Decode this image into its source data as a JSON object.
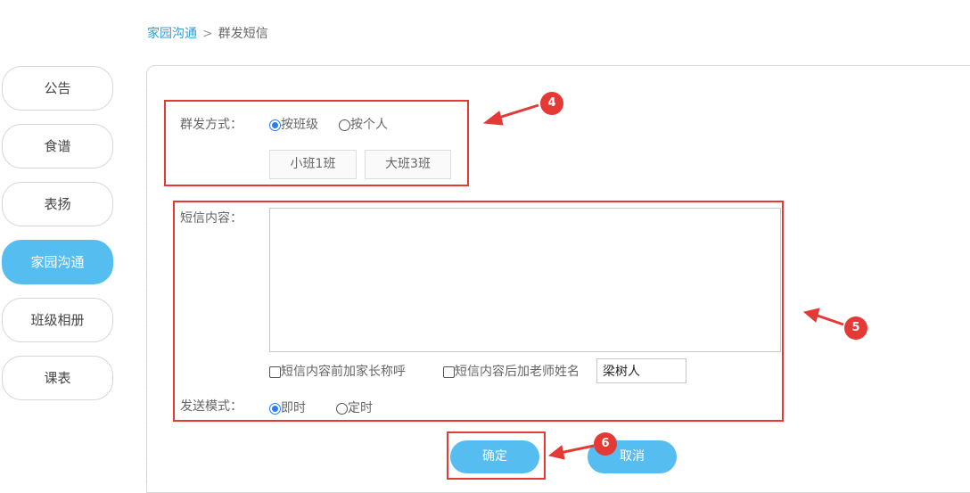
{
  "breadcrumb": {
    "parent": "家园沟通",
    "separator": ">",
    "current": "群发短信"
  },
  "sidebar": {
    "items": [
      {
        "label": "公告"
      },
      {
        "label": "食谱"
      },
      {
        "label": "表扬"
      },
      {
        "label": "家园沟通",
        "active": true
      },
      {
        "label": "班级相册"
      },
      {
        "label": "课表"
      }
    ]
  },
  "form": {
    "send_method": {
      "label": "群发方式：",
      "options": [
        {
          "label": "按班级",
          "checked": true
        },
        {
          "label": "按个人",
          "checked": false
        }
      ],
      "classes": [
        "小班1班",
        "大班3班"
      ]
    },
    "sms_content": {
      "label": "短信内容：",
      "value": ""
    },
    "prefix_parent_title": {
      "label": "短信内容前加家长称呼",
      "checked": false
    },
    "suffix_teacher_name": {
      "label": "短信内容后加老师姓名",
      "checked": false,
      "value": "梁树人"
    },
    "send_mode": {
      "label": "发送模式：",
      "options": [
        {
          "label": "即时",
          "checked": true
        },
        {
          "label": "定时",
          "checked": false
        }
      ]
    }
  },
  "actions": {
    "confirm": "确定",
    "cancel": "取消"
  },
  "annotations": {
    "badge4": "4",
    "badge5": "5",
    "badge6": "6"
  },
  "colors": {
    "accent": "#55bdf0",
    "highlight_red": "#e53935",
    "link": "#2ea0d6"
  }
}
